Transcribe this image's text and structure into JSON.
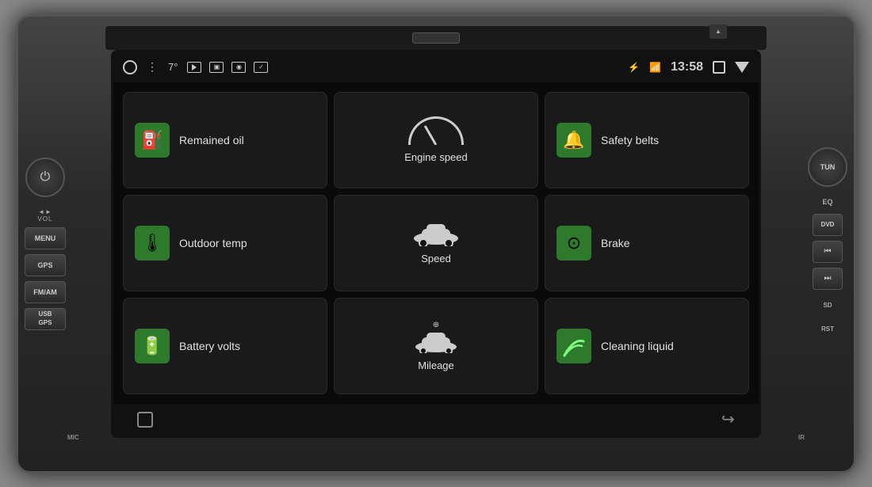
{
  "device": {
    "title": "Car Head Unit",
    "top_knob_left": "VOL",
    "top_knob_right": "TUN",
    "eq_label": "EQ",
    "left_buttons": [
      "MENU",
      "GPS",
      "FM/AM",
      "USB\nGPS"
    ],
    "right_buttons": [
      "DVD",
      "⏮",
      "⏭"
    ],
    "right_labels": [
      "SD\nRST"
    ],
    "bottom_labels": [
      "MIC",
      "IR"
    ]
  },
  "status_bar": {
    "temp": "7°",
    "time": "13:58",
    "bluetooth_icon": "bluetooth",
    "wifi_icon": "wifi"
  },
  "cards": [
    {
      "id": "remained-oil",
      "label": "Remained oil",
      "icon": "⛽",
      "icon_type": "green",
      "position": "left-top"
    },
    {
      "id": "engine-speed",
      "label": "Engine speed",
      "icon": "🌡",
      "icon_type": "center",
      "position": "center-top"
    },
    {
      "id": "safety-belts",
      "label": "Safety belts",
      "icon": "🔔",
      "icon_type": "green",
      "position": "right-top"
    },
    {
      "id": "outdoor-temp",
      "label": "Outdoor temp",
      "icon": "🌡",
      "icon_type": "green",
      "position": "left-mid"
    },
    {
      "id": "speed",
      "label": "Speed",
      "icon": "🚗",
      "icon_type": "center",
      "position": "center-mid"
    },
    {
      "id": "brake",
      "label": "Brake",
      "icon": "⚙",
      "icon_type": "green",
      "position": "right-mid"
    },
    {
      "id": "battery-volts",
      "label": "Battery volts",
      "icon": "🔋",
      "icon_type": "green",
      "position": "left-bot"
    },
    {
      "id": "mileage",
      "label": "Mileage",
      "icon": "🚙",
      "icon_type": "center",
      "position": "center-bot"
    },
    {
      "id": "cleaning-liquid",
      "label": "Cleaning liquid",
      "icon": "🪣",
      "icon_type": "green",
      "position": "right-bot"
    }
  ],
  "bottom_bar": {
    "home_icon": "home",
    "back_icon": "back"
  }
}
